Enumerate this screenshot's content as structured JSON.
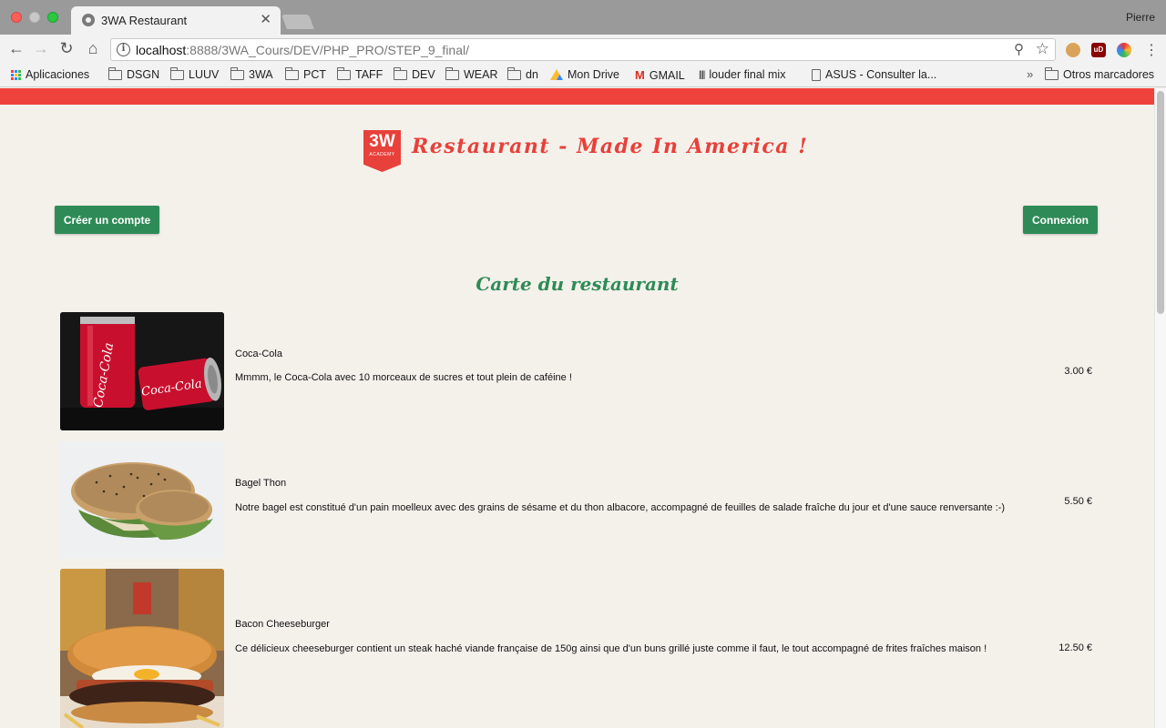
{
  "browser": {
    "tab_title": "3WA Restaurant",
    "tab_close": "✕",
    "profile": "Pierre",
    "url_host": "localhost",
    "url_rest": ":8888/3WA_Cours/DEV/PHP_PRO/STEP_9_final/",
    "bookmarks": [
      "Aplicaciones",
      "DSGN",
      "LUUV",
      "3WA",
      "PCT",
      "TAFF",
      "DEV",
      "WEAR",
      "dn",
      "Mon Drive",
      "GMAIL",
      "louder final mix",
      "ASUS - Consulter la...",
      "Otros marcadores"
    ],
    "more_bookmarks": "»"
  },
  "site": {
    "logo_text": "3W",
    "logo_sub": "ACADEMY",
    "title": "Restaurant - Made In America !",
    "signup_label": "Créer un compte",
    "login_label": "Connexion",
    "menu_heading": "Carte du restaurant"
  },
  "menu": [
    {
      "name": "Coca-Cola",
      "description": "Mmmm, le Coca-Cola avec 10 morceaux de sucres et tout plein de caféine !",
      "price": "3.00 €",
      "image": "coca-cola-cans"
    },
    {
      "name": "Bagel Thon",
      "description": "Notre bagel est constitué d'un pain moelleux avec des grains de sésame et du thon albacore, accompagné de feuilles de salade fraîche du jour et d'une sauce renversante :-)",
      "price": "5.50 €",
      "image": "tuna-bagel"
    },
    {
      "name": "Bacon Cheeseburger",
      "description": "Ce délicieux cheeseburger contient un steak haché viande française de 150g ainsi que d'un buns grillé juste comme il faut, le tout accompagné de frites fraîches maison !",
      "price": "12.50 €",
      "image": "bacon-cheeseburger"
    }
  ],
  "colors": {
    "accent_red": "#f0423c",
    "accent_green": "#2e8b57",
    "background": "#f4f1eb"
  }
}
